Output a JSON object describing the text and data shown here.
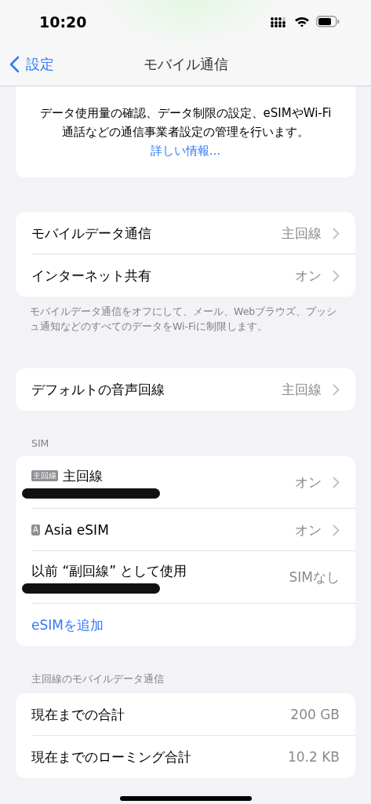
{
  "status_bar": {
    "time": "10:20"
  },
  "nav": {
    "back": "設定",
    "title": "モバイル通信"
  },
  "intro": {
    "text": "データ使用量の確認、データ制限の設定、eSIMやWi-Fi通話などの通信事業者設定の管理を行います。",
    "link": "詳しい情報..."
  },
  "groups": [
    {
      "rows": [
        {
          "label": "モバイルデータ通信",
          "value": "主回線",
          "chevron": true
        },
        {
          "label": "インターネット共有",
          "value": "オン",
          "chevron": true
        }
      ],
      "footer": "モバイルデータ通信をオフにして、メール、Webブラウズ、プッシュ通知などのすべてのデータをWi-Fiに制限します。"
    },
    {
      "rows": [
        {
          "label": "デフォルトの音声回線",
          "value": "主回線",
          "chevron": true
        }
      ]
    },
    {
      "header": "SIM",
      "rows": [
        {
          "badge": "主回線",
          "label": "主回線",
          "redacted": true,
          "value": "オン",
          "chevron": true
        },
        {
          "badge": "A",
          "label": "Asia eSIM",
          "value": "オン",
          "chevron": true
        },
        {
          "label": "以前 “副回線” として使用",
          "redacted": true,
          "value": "SIMなし",
          "chevron": false
        },
        {
          "label": "eSIMを追加",
          "kind": "action"
        }
      ]
    },
    {
      "header": "主回線のモバイルデータ通信",
      "rows": [
        {
          "label": "現在までの合計",
          "value": "200 GB",
          "chevron": false
        },
        {
          "label": "現在までのローミング合計",
          "value": "10.2 KB",
          "chevron": false
        }
      ]
    }
  ]
}
